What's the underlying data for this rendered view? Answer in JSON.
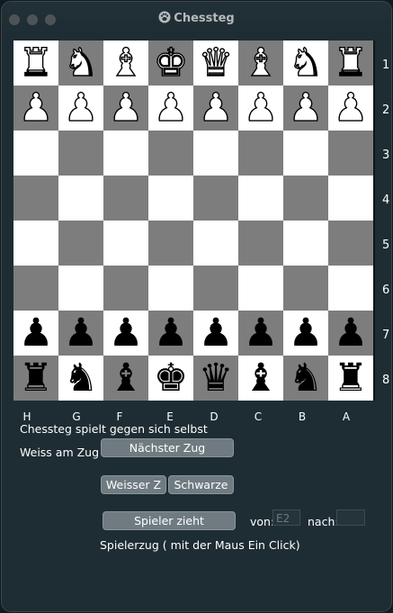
{
  "window": {
    "title": "Chessteg"
  },
  "board": {
    "squares": [
      [
        "♜",
        "♞",
        "♝",
        "♚",
        "♛",
        "♝",
        "♞",
        "♜"
      ],
      [
        "♟",
        "♟",
        "♟",
        "♟",
        "♟",
        "♟",
        "♟",
        "♟"
      ],
      [
        "",
        "",
        "",
        "",
        "",
        "",
        "",
        ""
      ],
      [
        "",
        "",
        "",
        "",
        "",
        "",
        "",
        ""
      ],
      [
        "",
        "",
        "",
        "",
        "",
        "",
        "",
        ""
      ],
      [
        "",
        "",
        "",
        "",
        "",
        "",
        "",
        ""
      ],
      [
        "♟",
        "♟",
        "♟",
        "♟",
        "♟",
        "♟",
        "♟",
        "♟"
      ],
      [
        "♜",
        "♞",
        "♝",
        "♚",
        "♛",
        "♝",
        "♞",
        "♜"
      ]
    ],
    "piece_colors": [
      "white",
      "white",
      "empty",
      "empty",
      "empty",
      "empty",
      "black",
      "black"
    ],
    "ranks": [
      "1",
      "2",
      "3",
      "4",
      "5",
      "6",
      "7",
      "8"
    ],
    "files": [
      "H",
      "G",
      "F",
      "E",
      "D",
      "C",
      "B",
      "A"
    ]
  },
  "status": {
    "mode_text": "Chessteg spielt gegen sich selbst",
    "turn_text": "Weiss am Zug"
  },
  "controls": {
    "next_move_label": "Nächster Zug",
    "white_label": "Weisser Z",
    "black_label": "Schwarze",
    "player_moves_label": "Spieler zieht",
    "from_label": "von:",
    "from_value": "E2",
    "to_label": "nach:",
    "to_value": "",
    "hint_text": "Spielerzug ( mit der Maus Ein Click)"
  }
}
